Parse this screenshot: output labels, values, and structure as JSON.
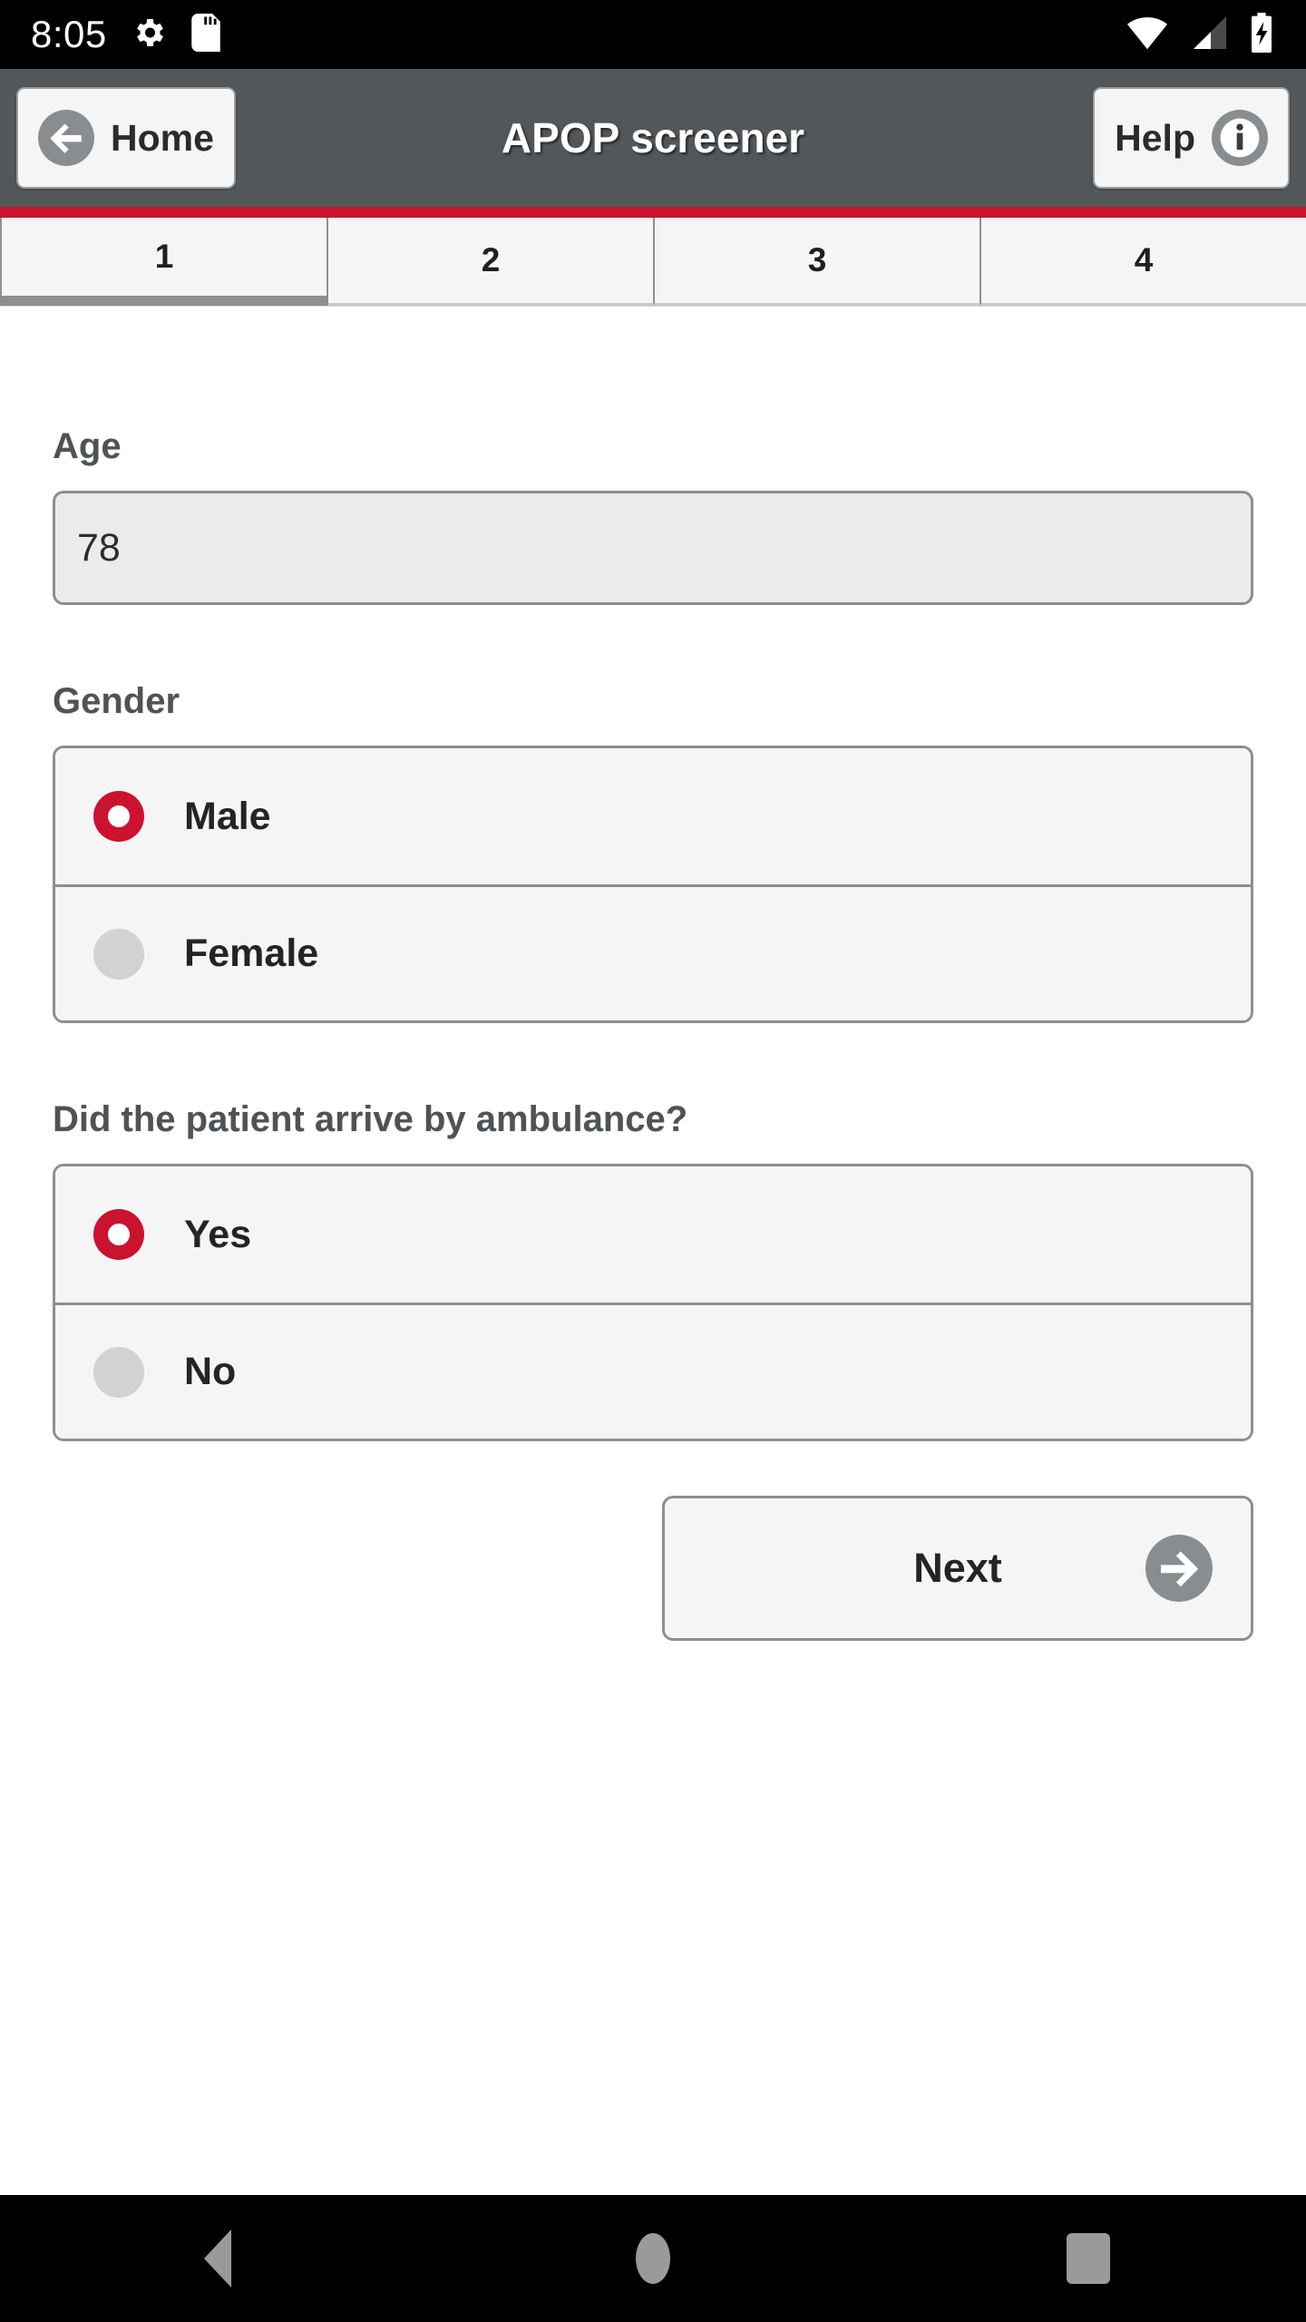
{
  "status_bar": {
    "clock": "8:05",
    "left_icons": [
      "gear-icon",
      "sd-card-icon"
    ],
    "right_icons": [
      "wifi-icon",
      "cellular-signal-icon",
      "battery-charging-icon"
    ]
  },
  "header": {
    "title": "APOP screener",
    "back_label": "Home",
    "back_icon": "arrow-left-circle-icon",
    "help_label": "Help",
    "help_icon": "info-circle-icon",
    "accent_color": "#cb122f",
    "bar_color": "#53575a"
  },
  "tabs": [
    {
      "label": "1",
      "selected": true
    },
    {
      "label": "2",
      "selected": false
    },
    {
      "label": "3",
      "selected": false
    },
    {
      "label": "4",
      "selected": false
    }
  ],
  "form": {
    "age": {
      "label": "Age",
      "value": "78",
      "placeholder": "Age"
    },
    "gender": {
      "label": "Gender",
      "options": [
        {
          "label": "Male",
          "selected": true
        },
        {
          "label": "Female",
          "selected": false
        }
      ]
    },
    "ambulance": {
      "label": "Did the patient arrive by ambulance?",
      "options": [
        {
          "label": "Yes",
          "selected": true
        },
        {
          "label": "No",
          "selected": false
        }
      ]
    },
    "next_label": "Next",
    "next_icon": "arrow-right-circle-icon"
  },
  "nav_bar": {
    "back": "back-triangle-icon",
    "home": "home-circle-icon",
    "recents": "recents-square-icon"
  }
}
